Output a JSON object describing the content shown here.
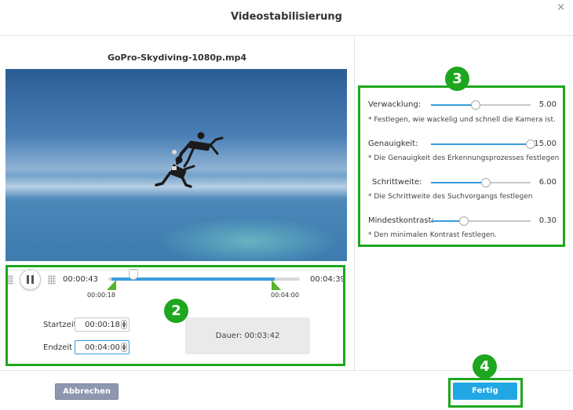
{
  "window": {
    "title": "Videostabilisierung",
    "close_glyph": "×"
  },
  "video": {
    "filename": "GoPro-Skydiving-1080p.mp4"
  },
  "playback": {
    "current_time": "00:00:43",
    "total_time": "00:04:39",
    "range_start_label": "00:00:18",
    "range_end_label": "00:04:00",
    "pause_icon": "pause-icon"
  },
  "trim": {
    "start_label": "Startzeit",
    "start_value": "00:00:18",
    "end_label": "Endzeit",
    "end_value": "00:04:00",
    "duration_label": "Dauer:",
    "duration_value": "00:03:42"
  },
  "settings": [
    {
      "label": "Verwacklung:",
      "value": "5.00",
      "fraction": 0.45,
      "hint": "* Festlegen, wie wackelig und schnell die Kamera ist."
    },
    {
      "label": "Genauigkeit:",
      "value": "15.00",
      "fraction": 1.0,
      "hint": "* Die Genauigkeit des Erkennungsprozesses festlegen"
    },
    {
      "label": "Schrittweite:",
      "value": "6.00",
      "fraction": 0.55,
      "hint": "* Die Schrittweite des Suchvorgangs festlegen"
    },
    {
      "label": "Mindestkontrast:",
      "value": "0.30",
      "fraction": 0.33,
      "hint": "* Den minimalen Kontrast festlegen."
    }
  ],
  "footer": {
    "cancel_label": "Abbrechen",
    "done_label": "Fertig"
  },
  "annotations": [
    "2",
    "3",
    "4"
  ],
  "colors": {
    "accent": "#3a9cdc",
    "annotation": "#1ea61e",
    "done_button": "#22a7e5",
    "cancel_button": "#8e97b0",
    "marker": "#57b52a"
  }
}
